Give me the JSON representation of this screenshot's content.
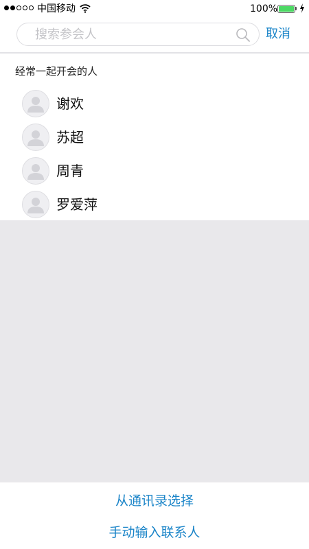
{
  "status_bar": {
    "carrier": "中国移动",
    "battery_percent": "100%",
    "signal_bars_filled": 2,
    "signal_bars_total": 5,
    "battery_level": 1.0,
    "battery_color": "#4cd964",
    "icons": [
      "signal-dots",
      "wifi-icon",
      "battery-icon",
      "charging-icon"
    ]
  },
  "search": {
    "placeholder": "搜索参会人",
    "value": "",
    "cancel_label": "取消",
    "icon": "search-icon"
  },
  "frequent": {
    "title": "经常一起开会的人",
    "contacts": [
      {
        "name": "谢欢",
        "avatar": "default-avatar-icon"
      },
      {
        "name": "苏超",
        "avatar": "default-avatar-icon"
      },
      {
        "name": "周青",
        "avatar": "default-avatar-icon"
      },
      {
        "name": "罗爱萍",
        "avatar": "default-avatar-icon"
      }
    ]
  },
  "actions": {
    "from_contacts_label": "从通讯录选择",
    "manual_entry_label": "手动输入联系人"
  },
  "colors": {
    "accent": "#1a84c8",
    "background_gray": "#e9e8eb",
    "battery_green": "#4cd964"
  }
}
